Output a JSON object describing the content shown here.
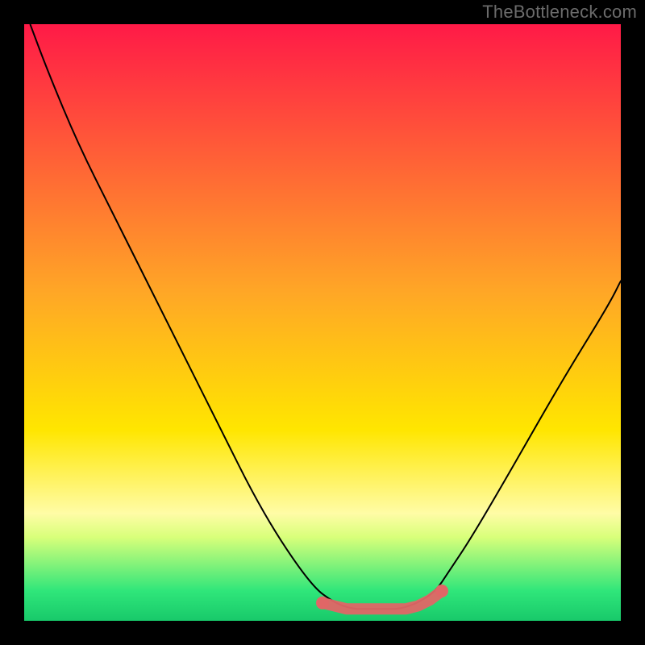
{
  "watermark": "TheBottleneck.com",
  "chart_data": {
    "type": "line",
    "title": "",
    "xlabel": "",
    "ylabel": "",
    "xlim": [
      0,
      100
    ],
    "ylim": [
      0,
      100
    ],
    "grid": false,
    "legend": false,
    "gradient_stops": [
      {
        "offset": 0.0,
        "color": "#ff1a47"
      },
      {
        "offset": 0.45,
        "color": "#ffa726"
      },
      {
        "offset": 0.68,
        "color": "#ffe600"
      },
      {
        "offset": 0.82,
        "color": "#fffca6"
      },
      {
        "offset": 0.86,
        "color": "#d8ff7a"
      },
      {
        "offset": 0.95,
        "color": "#2fe67a"
      },
      {
        "offset": 1.0,
        "color": "#18c96a"
      }
    ],
    "series": [
      {
        "name": "bottleneck-curve",
        "type": "line",
        "x": [
          1,
          4,
          9,
          15,
          23,
          32,
          40,
          48,
          52,
          55,
          57,
          59,
          61,
          63,
          66,
          69,
          71,
          75,
          82,
          90,
          98,
          100
        ],
        "y": [
          100,
          92,
          80,
          68,
          52,
          34,
          18,
          6,
          3,
          2,
          2,
          2,
          2,
          2,
          3,
          5,
          8,
          14,
          26,
          40,
          53,
          57
        ]
      },
      {
        "name": "valley-highlight",
        "type": "scatter",
        "x": [
          50,
          52,
          54,
          56,
          58,
          60,
          62,
          64,
          66,
          68,
          70
        ],
        "y": [
          3,
          2.5,
          2,
          2,
          2,
          2,
          2,
          2,
          2.5,
          3.5,
          5
        ]
      }
    ]
  }
}
